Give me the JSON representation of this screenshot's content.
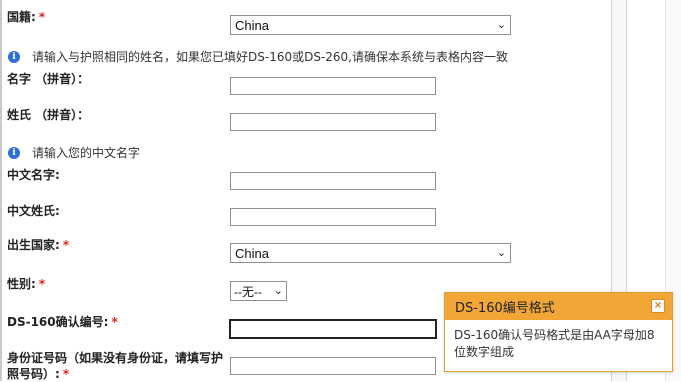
{
  "fields": {
    "nationality_label": "国籍:",
    "nationality_value": "China",
    "tip1": "请输入与护照相同的姓名，如果您已填好DS-160或DS-260,请确保本系统与表格内容一致",
    "given_name_label": "名字 （拼音）：",
    "surname_label": "姓氏 （拼音）：",
    "tip2": "请输入您的中文名字",
    "cn_given_label": "中文名字:",
    "cn_surname_label": "中文姓氏:",
    "birth_country_label": "出生国家:",
    "birth_country_value": "China",
    "gender_label": "性别:",
    "gender_value": "--无--",
    "ds160_label": "DS-160确认编号:",
    "id_label_line1": "身份证号码（如果没有身份证，请填写护",
    "id_label_line2": "照号码）:",
    "required_mark": "*"
  },
  "popover": {
    "title": "DS-160编号格式",
    "close": "×",
    "body": "DS-160确认号码格式是由AA字母加8位数字组成"
  },
  "icons": {
    "info": "i"
  },
  "colors": {
    "required": "#d9231c",
    "popover_header": "#f2a636",
    "info_icon": "#2f6fd6"
  }
}
